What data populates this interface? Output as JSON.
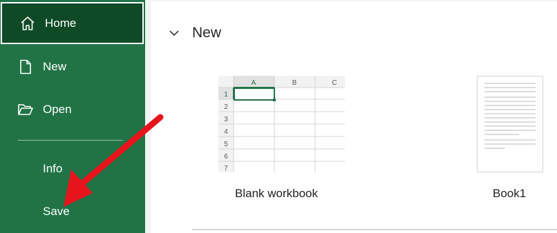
{
  "sidebar": {
    "items": [
      {
        "label": "Home",
        "icon": "home-icon"
      },
      {
        "label": "New",
        "icon": "new-file-icon"
      },
      {
        "label": "Open",
        "icon": "folder-open-icon"
      },
      {
        "label": "Info"
      },
      {
        "label": "Save"
      }
    ],
    "selected": "Home"
  },
  "main": {
    "section_title": "New",
    "templates": [
      {
        "label": "Blank workbook",
        "columns": [
          "A",
          "B",
          "C"
        ],
        "rows": [
          "1",
          "2",
          "3",
          "4",
          "5",
          "6",
          "7"
        ]
      },
      {
        "label": "Book1"
      }
    ]
  },
  "colors": {
    "sidebar": "#217346",
    "sidebar_selected": "#0e4a26",
    "annotation_arrow": "#e8141b"
  }
}
